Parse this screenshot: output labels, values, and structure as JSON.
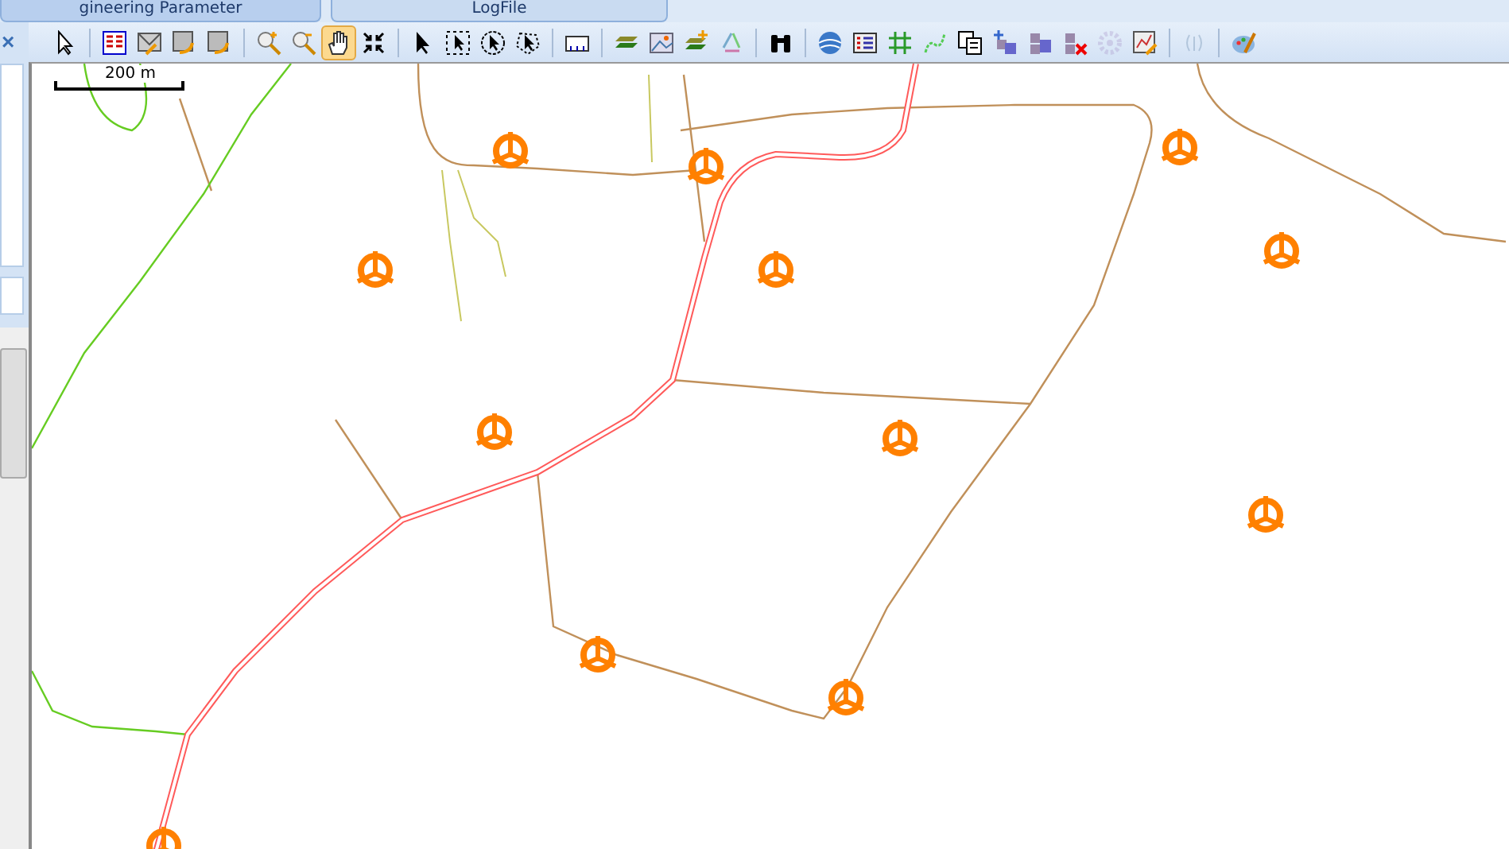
{
  "tabs": [
    {
      "label": "gineering Parameter",
      "selected": false
    },
    {
      "label": "LogFile",
      "selected": true
    }
  ],
  "side_panel": {
    "close": "×"
  },
  "toolbar": {
    "groups": [
      [
        {
          "selected": false,
          "disabled": false
        }
      ],
      [
        {
          "selected": false,
          "disabled": false
        },
        {
          "selected": false,
          "disabled": false
        },
        {
          "selected": false,
          "disabled": false
        },
        {
          "selected": false,
          "disabled": false
        }
      ],
      [
        {
          "selected": false,
          "disabled": false
        },
        {
          "selected": false,
          "disabled": false
        },
        {
          "selected": true,
          "disabled": false
        },
        {
          "selected": false,
          "disabled": false
        }
      ],
      [
        {
          "selected": false,
          "disabled": false
        },
        {
          "selected": false,
          "disabled": false
        },
        {
          "selected": false,
          "disabled": false
        },
        {
          "selected": false,
          "disabled": false
        }
      ],
      [
        {
          "selected": false,
          "disabled": false
        }
      ],
      [
        {
          "selected": false,
          "disabled": false
        },
        {
          "selected": false,
          "disabled": false
        },
        {
          "selected": false,
          "disabled": false
        },
        {
          "selected": false,
          "disabled": false
        }
      ],
      [
        {
          "selected": false,
          "disabled": false
        }
      ],
      [
        {
          "selected": false,
          "disabled": false
        },
        {
          "selected": false,
          "disabled": false
        },
        {
          "selected": false,
          "disabled": false
        },
        {
          "selected": false,
          "disabled": false
        },
        {
          "selected": false,
          "disabled": false
        },
        {
          "selected": false,
          "disabled": false
        },
        {
          "selected": false,
          "disabled": false
        },
        {
          "selected": false,
          "disabled": false
        },
        {
          "selected": false,
          "disabled": true
        },
        {
          "selected": false,
          "disabled": false
        }
      ],
      [
        {
          "selected": false,
          "disabled": true
        }
      ],
      [
        {
          "selected": false,
          "disabled": false
        }
      ]
    ]
  },
  "map": {
    "scale_label": "200 m"
  }
}
